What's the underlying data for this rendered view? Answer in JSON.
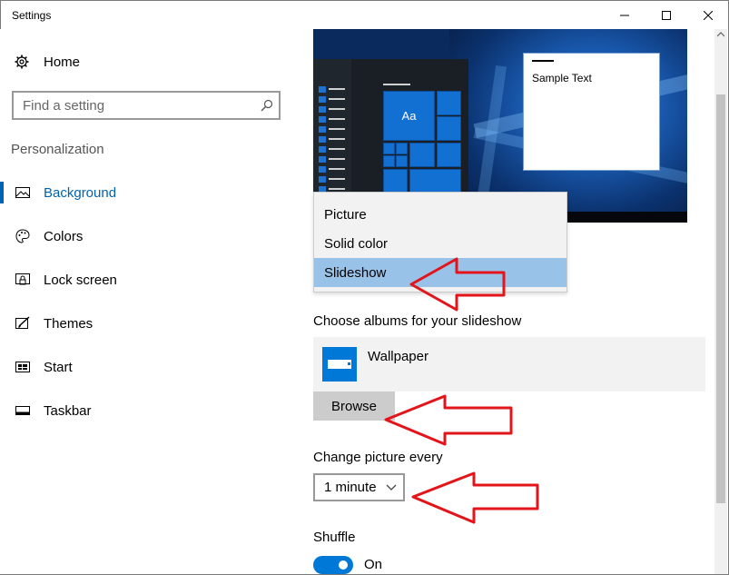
{
  "window": {
    "title": "Settings",
    "controls": {
      "minimize": "minimize-icon",
      "maximize": "maximize-icon",
      "close": "close-icon"
    }
  },
  "sidebar": {
    "home": {
      "label": "Home",
      "icon": "gear-icon"
    },
    "search": {
      "placeholder": "Find a setting",
      "icon": "search-icon"
    },
    "section_title": "Personalization",
    "items": [
      {
        "label": "Background",
        "icon": "image-icon",
        "active": true
      },
      {
        "label": "Colors",
        "icon": "palette-icon",
        "active": false
      },
      {
        "label": "Lock screen",
        "icon": "lock-screen-icon",
        "active": false
      },
      {
        "label": "Themes",
        "icon": "brush-icon",
        "active": false
      },
      {
        "label": "Start",
        "icon": "start-tiles-icon",
        "active": false
      },
      {
        "label": "Taskbar",
        "icon": "taskbar-icon",
        "active": false
      }
    ]
  },
  "preview": {
    "tile_label": "Aa",
    "sample_text": "Sample Text"
  },
  "background_dropdown": {
    "options": [
      "Picture",
      "Solid color",
      "Slideshow"
    ],
    "selected": "Slideshow"
  },
  "slideshow": {
    "albums_label": "Choose albums for your slideshow",
    "album_name": "Wallpaper",
    "browse_label": "Browse",
    "interval_label": "Change picture every",
    "interval_value": "1 minute",
    "shuffle_label": "Shuffle",
    "shuffle_state": "On"
  },
  "annotations": {
    "arrow_color": "#e3141a"
  },
  "colors": {
    "accent": "#0078d7",
    "active_nav": "#0063b1",
    "selection": "#99c2e8"
  }
}
